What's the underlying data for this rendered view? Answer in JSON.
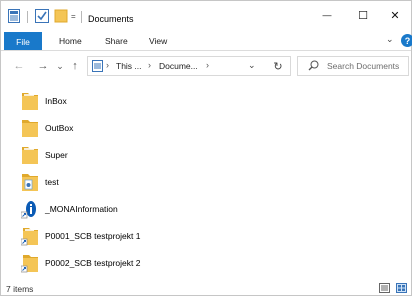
{
  "window": {
    "title": "Documents",
    "controls": {
      "minimize": "—",
      "maximize": "☐",
      "close": "✕"
    }
  },
  "ribbon": {
    "tabs": [
      {
        "label": "File",
        "active": true
      },
      {
        "label": "Home"
      },
      {
        "label": "Share"
      },
      {
        "label": "View"
      }
    ],
    "expand_icon": "chevron-down-icon",
    "help_label": "?"
  },
  "nav": {
    "back_icon": "←",
    "forward_icon": "→",
    "recent_icon": "⌄",
    "up_icon": "↑",
    "address": {
      "parts": [
        "This ...",
        "Docume..."
      ],
      "separator": "›"
    },
    "refresh_icon": "↻",
    "search_placeholder": "Search Documents"
  },
  "items": [
    {
      "name": "InBox",
      "icon": "folder-icon",
      "shortcut": false
    },
    {
      "name": "OutBox",
      "icon": "folder-icon",
      "shortcut": false
    },
    {
      "name": "Super",
      "icon": "folder-icon",
      "shortcut": false
    },
    {
      "name": "test",
      "icon": "folder-icon",
      "shortcut": false
    },
    {
      "name": "_MONAInformation",
      "icon": "info-shortcut-icon",
      "shortcut": true
    },
    {
      "name": "P0001_SCB testprojekt 1",
      "icon": "folder-shortcut-icon",
      "shortcut": true
    },
    {
      "name": "P0002_SCB testprojekt 2",
      "icon": "folder-shortcut-icon",
      "shortcut": true
    }
  ],
  "status": {
    "count": "7 items"
  },
  "colors": {
    "accent": "#1979ca",
    "folder": "#f4c556",
    "folder_dark": "#e0a92c"
  }
}
